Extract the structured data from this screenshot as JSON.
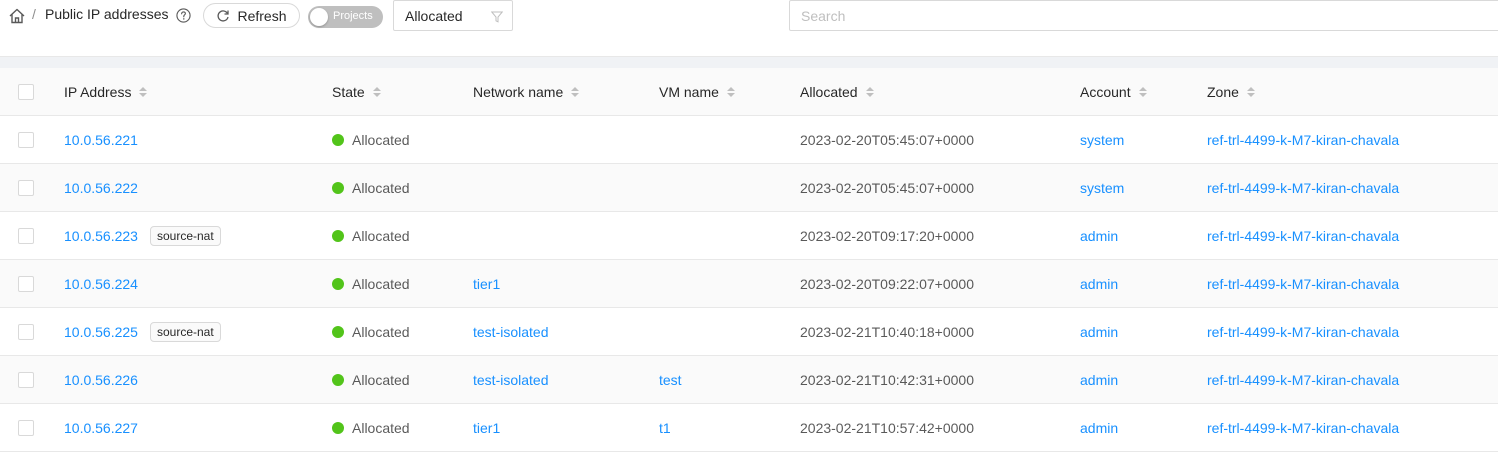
{
  "breadcrumb": {
    "separator": "/",
    "title": "Public IP addresses"
  },
  "toolbar": {
    "refresh_label": "Refresh",
    "projects_label": "Projects",
    "filter_value": "Allocated",
    "search_placeholder": "Search"
  },
  "colors": {
    "link": "#1890ff",
    "state_allocated": "#52c41a"
  },
  "table": {
    "columns": [
      "IP Address",
      "State",
      "Network name",
      "VM name",
      "Allocated",
      "Account",
      "Zone"
    ],
    "rows": [
      {
        "ip": "10.0.56.221",
        "tag": "",
        "state": "Allocated",
        "network": "",
        "vm": "",
        "allocated": "2023-02-20T05:45:07+0000",
        "account": "system",
        "zone": "ref-trl-4499-k-M7-kiran-chavala"
      },
      {
        "ip": "10.0.56.222",
        "tag": "",
        "state": "Allocated",
        "network": "",
        "vm": "",
        "allocated": "2023-02-20T05:45:07+0000",
        "account": "system",
        "zone": "ref-trl-4499-k-M7-kiran-chavala"
      },
      {
        "ip": "10.0.56.223",
        "tag": "source-nat",
        "state": "Allocated",
        "network": "",
        "vm": "",
        "allocated": "2023-02-20T09:17:20+0000",
        "account": "admin",
        "zone": "ref-trl-4499-k-M7-kiran-chavala"
      },
      {
        "ip": "10.0.56.224",
        "tag": "",
        "state": "Allocated",
        "network": "tier1",
        "vm": "",
        "allocated": "2023-02-20T09:22:07+0000",
        "account": "admin",
        "zone": "ref-trl-4499-k-M7-kiran-chavala"
      },
      {
        "ip": "10.0.56.225",
        "tag": "source-nat",
        "state": "Allocated",
        "network": "test-isolated",
        "vm": "",
        "allocated": "2023-02-21T10:40:18+0000",
        "account": "admin",
        "zone": "ref-trl-4499-k-M7-kiran-chavala"
      },
      {
        "ip": "10.0.56.226",
        "tag": "",
        "state": "Allocated",
        "network": "test-isolated",
        "vm": "test",
        "allocated": "2023-02-21T10:42:31+0000",
        "account": "admin",
        "zone": "ref-trl-4499-k-M7-kiran-chavala"
      },
      {
        "ip": "10.0.56.227",
        "tag": "",
        "state": "Allocated",
        "network": "tier1",
        "vm": "t1",
        "allocated": "2023-02-21T10:57:42+0000",
        "account": "admin",
        "zone": "ref-trl-4499-k-M7-kiran-chavala"
      }
    ]
  }
}
